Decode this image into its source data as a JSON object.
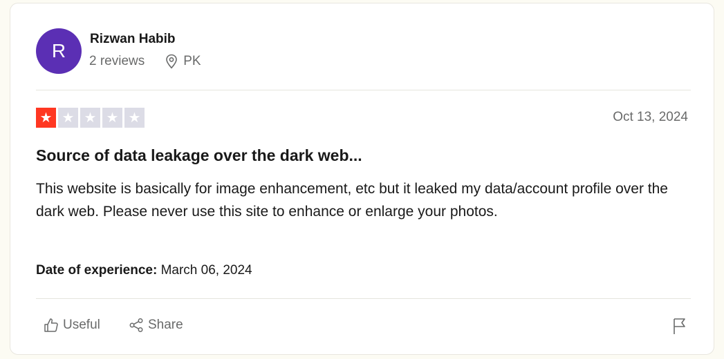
{
  "reviewer": {
    "initial": "R",
    "name": "Rizwan Habib",
    "review_count": "2 reviews",
    "country": "PK",
    "avatar_color": "#5b2fb4"
  },
  "review": {
    "rating": 1,
    "rating_max": 5,
    "filled_star_color": "#ff3722",
    "empty_star_color": "#dcdce6",
    "date": "Oct 13, 2024",
    "title": "Source of data leakage over the dark web...",
    "body": "This website is basically for image enhancement, etc but it leaked my data/account profile over the dark web. Please never use this site to enhance or enlarge your photos.",
    "experience_label": "Date of experience:",
    "experience_date": "March 06, 2024"
  },
  "actions": {
    "useful_label": "Useful",
    "share_label": "Share",
    "useful_icon": "thumbs-up-icon",
    "share_icon": "share-icon",
    "flag_icon": "flag-icon"
  }
}
